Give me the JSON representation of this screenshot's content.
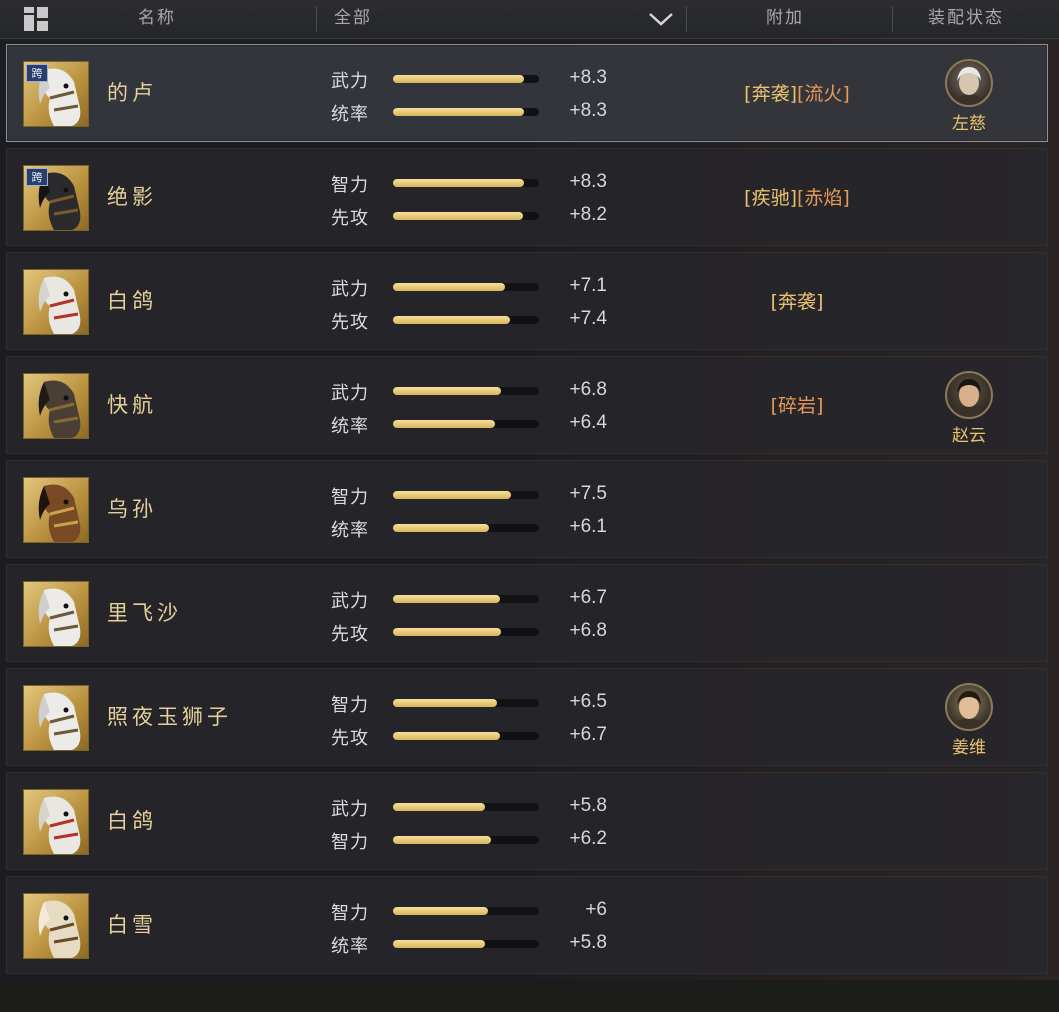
{
  "header": {
    "name_col": "名称",
    "filter_value": "全部",
    "bonus_col": "附加",
    "equip_col": "装配状态"
  },
  "horses": [
    {
      "name": "的卢",
      "cross": true,
      "cross_label": "跨",
      "coat": "white",
      "selected": true,
      "stats": [
        {
          "label": "武力",
          "value": "+8.3",
          "level": 0.9
        },
        {
          "label": "统率",
          "value": "+8.3",
          "level": 0.9
        }
      ],
      "tags": [
        {
          "text": "[奔袭]",
          "color": "gold"
        },
        {
          "text": "[流火]",
          "color": "orange"
        }
      ],
      "general": {
        "name": "左慈",
        "portrait": "old-sage"
      }
    },
    {
      "name": "绝影",
      "cross": true,
      "cross_label": "跨",
      "coat": "black",
      "selected": false,
      "stats": [
        {
          "label": "智力",
          "value": "+8.3",
          "level": 0.9
        },
        {
          "label": "先攻",
          "value": "+8.2",
          "level": 0.89
        }
      ],
      "tags": [
        {
          "text": "[疾驰]",
          "color": "gold"
        },
        {
          "text": "[赤焰]",
          "color": "orange"
        }
      ],
      "general": null
    },
    {
      "name": "白鸽",
      "cross": false,
      "coat": "white-red",
      "selected": false,
      "stats": [
        {
          "label": "武力",
          "value": "+7.1",
          "level": 0.77
        },
        {
          "label": "先攻",
          "value": "+7.4",
          "level": 0.8
        }
      ],
      "tags": [
        {
          "text": "[奔袭]",
          "color": "gold"
        }
      ],
      "general": null
    },
    {
      "name": "快航",
      "cross": false,
      "coat": "dark",
      "selected": false,
      "stats": [
        {
          "label": "武力",
          "value": "+6.8",
          "level": 0.74
        },
        {
          "label": "统率",
          "value": "+6.4",
          "level": 0.7
        }
      ],
      "tags": [
        {
          "text": "[碎岩]",
          "color": "orange"
        }
      ],
      "general": {
        "name": "赵云",
        "portrait": "young-warrior"
      }
    },
    {
      "name": "乌孙",
      "cross": false,
      "coat": "bay",
      "selected": false,
      "stats": [
        {
          "label": "智力",
          "value": "+7.5",
          "level": 0.81
        },
        {
          "label": "统率",
          "value": "+6.1",
          "level": 0.66
        }
      ],
      "tags": [],
      "general": null
    },
    {
      "name": "里飞沙",
      "cross": false,
      "coat": "white",
      "selected": false,
      "stats": [
        {
          "label": "武力",
          "value": "+6.7",
          "level": 0.73
        },
        {
          "label": "先攻",
          "value": "+6.8",
          "level": 0.74
        }
      ],
      "tags": [],
      "general": null
    },
    {
      "name": "照夜玉狮子",
      "cross": false,
      "coat": "white",
      "selected": false,
      "stats": [
        {
          "label": "智力",
          "value": "+6.5",
          "level": 0.71
        },
        {
          "label": "先攻",
          "value": "+6.7",
          "level": 0.73
        }
      ],
      "tags": [],
      "general": {
        "name": "姜维",
        "portrait": "young-scholar"
      }
    },
    {
      "name": "白鸽",
      "cross": false,
      "coat": "white-red",
      "selected": false,
      "stats": [
        {
          "label": "武力",
          "value": "+5.8",
          "level": 0.63
        },
        {
          "label": "智力",
          "value": "+6.2",
          "level": 0.67
        }
      ],
      "tags": [],
      "general": null
    },
    {
      "name": "白雪",
      "cross": false,
      "coat": "cream",
      "selected": false,
      "stats": [
        {
          "label": "智力",
          "value": "+6",
          "level": 0.65
        },
        {
          "label": "统率",
          "value": "+5.8",
          "level": 0.63
        }
      ],
      "tags": [],
      "general": null
    }
  ],
  "colors": {
    "gold_tag": "#e8c26e",
    "orange_tag": "#e69a5a",
    "bar_fill": "#f0d58a",
    "name_text": "#e6d09a"
  }
}
